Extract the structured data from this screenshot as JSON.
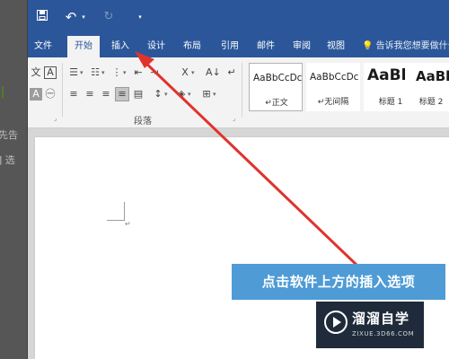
{
  "background_text": {
    "line1": "先告",
    "line2": "] 选"
  },
  "quick_access": {
    "save_icon": "save-icon",
    "undo_icon": "undo-icon",
    "redo_icon": "redo-icon",
    "customize_icon": "customize-qat-icon"
  },
  "tabs": {
    "file": "文件",
    "home": "开始",
    "insert": "插入",
    "design": "设计",
    "layout": "布局",
    "references": "引用",
    "mailings": "邮件",
    "review": "审阅",
    "view": "视图",
    "active": "开始"
  },
  "tell_me": {
    "text": "告诉我您想要做什么..."
  },
  "ribbon": {
    "paragraph_group_label": "段落",
    "styles": [
      {
        "sample": "AaBbCcDc",
        "name": "正文",
        "selected": true
      },
      {
        "sample": "AaBbCcDc",
        "name": "无间隔",
        "selected": false
      },
      {
        "sample": "AaBl",
        "name": "标题 1",
        "selected": false
      },
      {
        "sample": "AaBb",
        "name": "标题 2",
        "selected": false
      }
    ]
  },
  "annotation": {
    "callout": "点击软件上方的插入选项",
    "arrow_color": "#e0332c"
  },
  "watermark": {
    "title": "溜溜自学",
    "subtitle": "ZIXUE.3D66.COM"
  },
  "colors": {
    "title_bar": "#2b579a",
    "ribbon_bg": "#f3f3f3",
    "callout_bg": "#4e9bd6"
  }
}
